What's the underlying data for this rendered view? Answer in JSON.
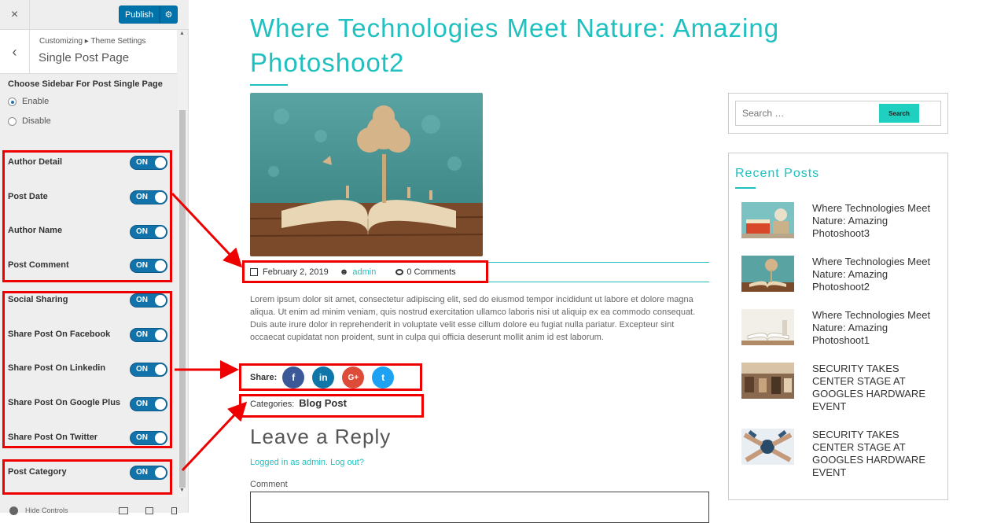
{
  "customizer": {
    "close_icon": "×",
    "publish_label": "Publish",
    "gear_icon": "⚙",
    "back_icon": "‹",
    "breadcrumb": "Customizing ▸ Theme Settings",
    "section_title": "Single Post Page",
    "sidebar_choice_label": "Choose Sidebar For Post Single Page",
    "radio_options": [
      {
        "label": "Enable",
        "checked": true
      },
      {
        "label": "Disable",
        "checked": false
      }
    ],
    "toggles": [
      {
        "label": "Author Detail",
        "state": "ON"
      },
      {
        "label": "Post Date",
        "state": "ON"
      },
      {
        "label": "Author Name",
        "state": "ON"
      },
      {
        "label": "Post Comment",
        "state": "ON"
      },
      {
        "label": "Social Sharing",
        "state": "ON"
      },
      {
        "label": "Share Post On Facebook",
        "state": "ON"
      },
      {
        "label": "Share Post On Linkedin",
        "state": "ON"
      },
      {
        "label": "Share Post On Google Plus",
        "state": "ON"
      },
      {
        "label": "Share Post On Twitter",
        "state": "ON"
      },
      {
        "label": "Post Category",
        "state": "ON"
      }
    ],
    "hide_controls_label": "Hide Controls"
  },
  "post": {
    "title": "Where Technologies Meet Nature: Amazing Photoshoot2",
    "date": "February 2, 2019",
    "author": "admin",
    "comments": "0 Comments",
    "excerpt": "Lorem ipsum dolor sit amet, consectetur adipiscing elit, sed do eiusmod tempor incididunt ut labore et dolore magna aliqua. Ut enim ad minim veniam, quis nostrud exercitation ullamco laboris nisi ut aliquip ex ea commodo consequat. Duis aute irure dolor in reprehenderit in voluptate velit esse cillum dolore eu fugiat nulla pariatur. Excepteur sint occaecat cupidatat non proident, sunt in culpa qui officia deserunt mollit anim id est laborum.",
    "share_label": "Share:",
    "share_buttons": [
      {
        "icon": "facebook-icon",
        "glyph": "f",
        "color": "#3b5998"
      },
      {
        "icon": "linkedin-icon",
        "glyph": "in",
        "color": "#0e76a8"
      },
      {
        "icon": "google-plus-icon",
        "glyph": "G+",
        "color": "#dd4b39"
      },
      {
        "icon": "twitter-icon",
        "glyph": "t",
        "color": "#1da1f2"
      }
    ],
    "categories_label": "Categories:",
    "category": "Blog Post",
    "reply_title": "Leave a Reply",
    "logged_in_text": "Logged in as admin. Log out?",
    "comment_label": "Comment"
  },
  "sidebar": {
    "search_placeholder": "Search …",
    "search_button": "Search",
    "recent_title": "Recent Posts",
    "recent_posts": [
      {
        "title": "Where Technologies Meet Nature: Amazing Photoshoot3"
      },
      {
        "title": "Where Technologies Meet Nature: Amazing Photoshoot2"
      },
      {
        "title": "Where Technologies Meet Nature: Amazing Photoshoot1"
      },
      {
        "title": "SECURITY TAKES CENTER STAGE AT GOOGLES HARDWARE EVENT"
      },
      {
        "title": "SECURITY TAKES CENTER STAGE AT GOOGLES HARDWARE EVENT"
      }
    ]
  },
  "colors": {
    "accent": "#1fc0c0",
    "toggle": "#1273ab",
    "publish": "#0073aa",
    "annotation": "#ee0000"
  }
}
